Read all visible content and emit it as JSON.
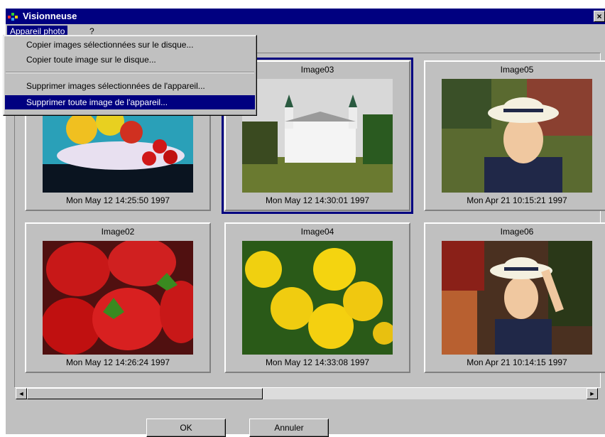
{
  "window": {
    "title": "Visionneuse",
    "close": "×"
  },
  "menubar": {
    "items": [
      {
        "label": "Appareil photo"
      },
      {
        "label": "?"
      }
    ]
  },
  "dropdown": {
    "items": [
      {
        "label": "Copier images sélectionnées sur le disque..."
      },
      {
        "label": "Copier toute image sur le disque..."
      },
      {
        "label": "Supprimer images sélectionnées de l'appareil..."
      },
      {
        "label": "Supprimer toute image de l'appareil..."
      }
    ]
  },
  "thumbnails": [
    {
      "name": "",
      "date": "Mon May 12 14:25:50 1997",
      "subject": "fruit-bowl"
    },
    {
      "name": "Image03",
      "date": "Mon May 12 14:30:01 1997",
      "subject": "castle",
      "selected": true
    },
    {
      "name": "Image05",
      "date": "Mon Apr 21 10:15:21 1997",
      "subject": "woman-hat"
    },
    {
      "name": "Image02",
      "date": "Mon May 12 14:26:24 1997",
      "subject": "strawberries"
    },
    {
      "name": "Image04",
      "date": "Mon May 12 14:33:08 1997",
      "subject": "dandelions"
    },
    {
      "name": "Image06",
      "date": "Mon Apr 21 10:14:15 1997",
      "subject": "woman-hat-2"
    }
  ],
  "scrollbar": {
    "left_arrow": "◄",
    "right_arrow": "►"
  },
  "buttons": {
    "ok": "OK",
    "cancel": "Annuler"
  }
}
